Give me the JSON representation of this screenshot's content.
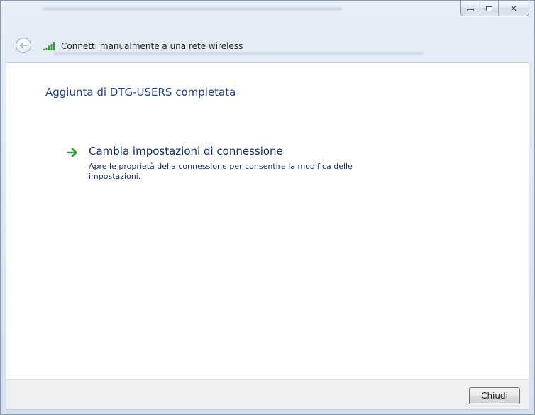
{
  "window": {
    "title": "Connetti manualmente a una rete wireless"
  },
  "caption": {
    "minimize": "minimize",
    "maximize": "maximize",
    "close_symbol": "✕"
  },
  "content": {
    "headline": "Aggiunta di DTG-USERS completata",
    "option": {
      "title": "Cambia impostazioni di connessione",
      "description": "Apre le proprietà della connessione per consentire la modifica delle impostazioni."
    }
  },
  "footer": {
    "close_label": "Chiudi"
  },
  "colors": {
    "heading": "#1e3f8a",
    "link": "#152f6d",
    "arrow": "#2da12d",
    "signal": "#2f9e2f"
  }
}
